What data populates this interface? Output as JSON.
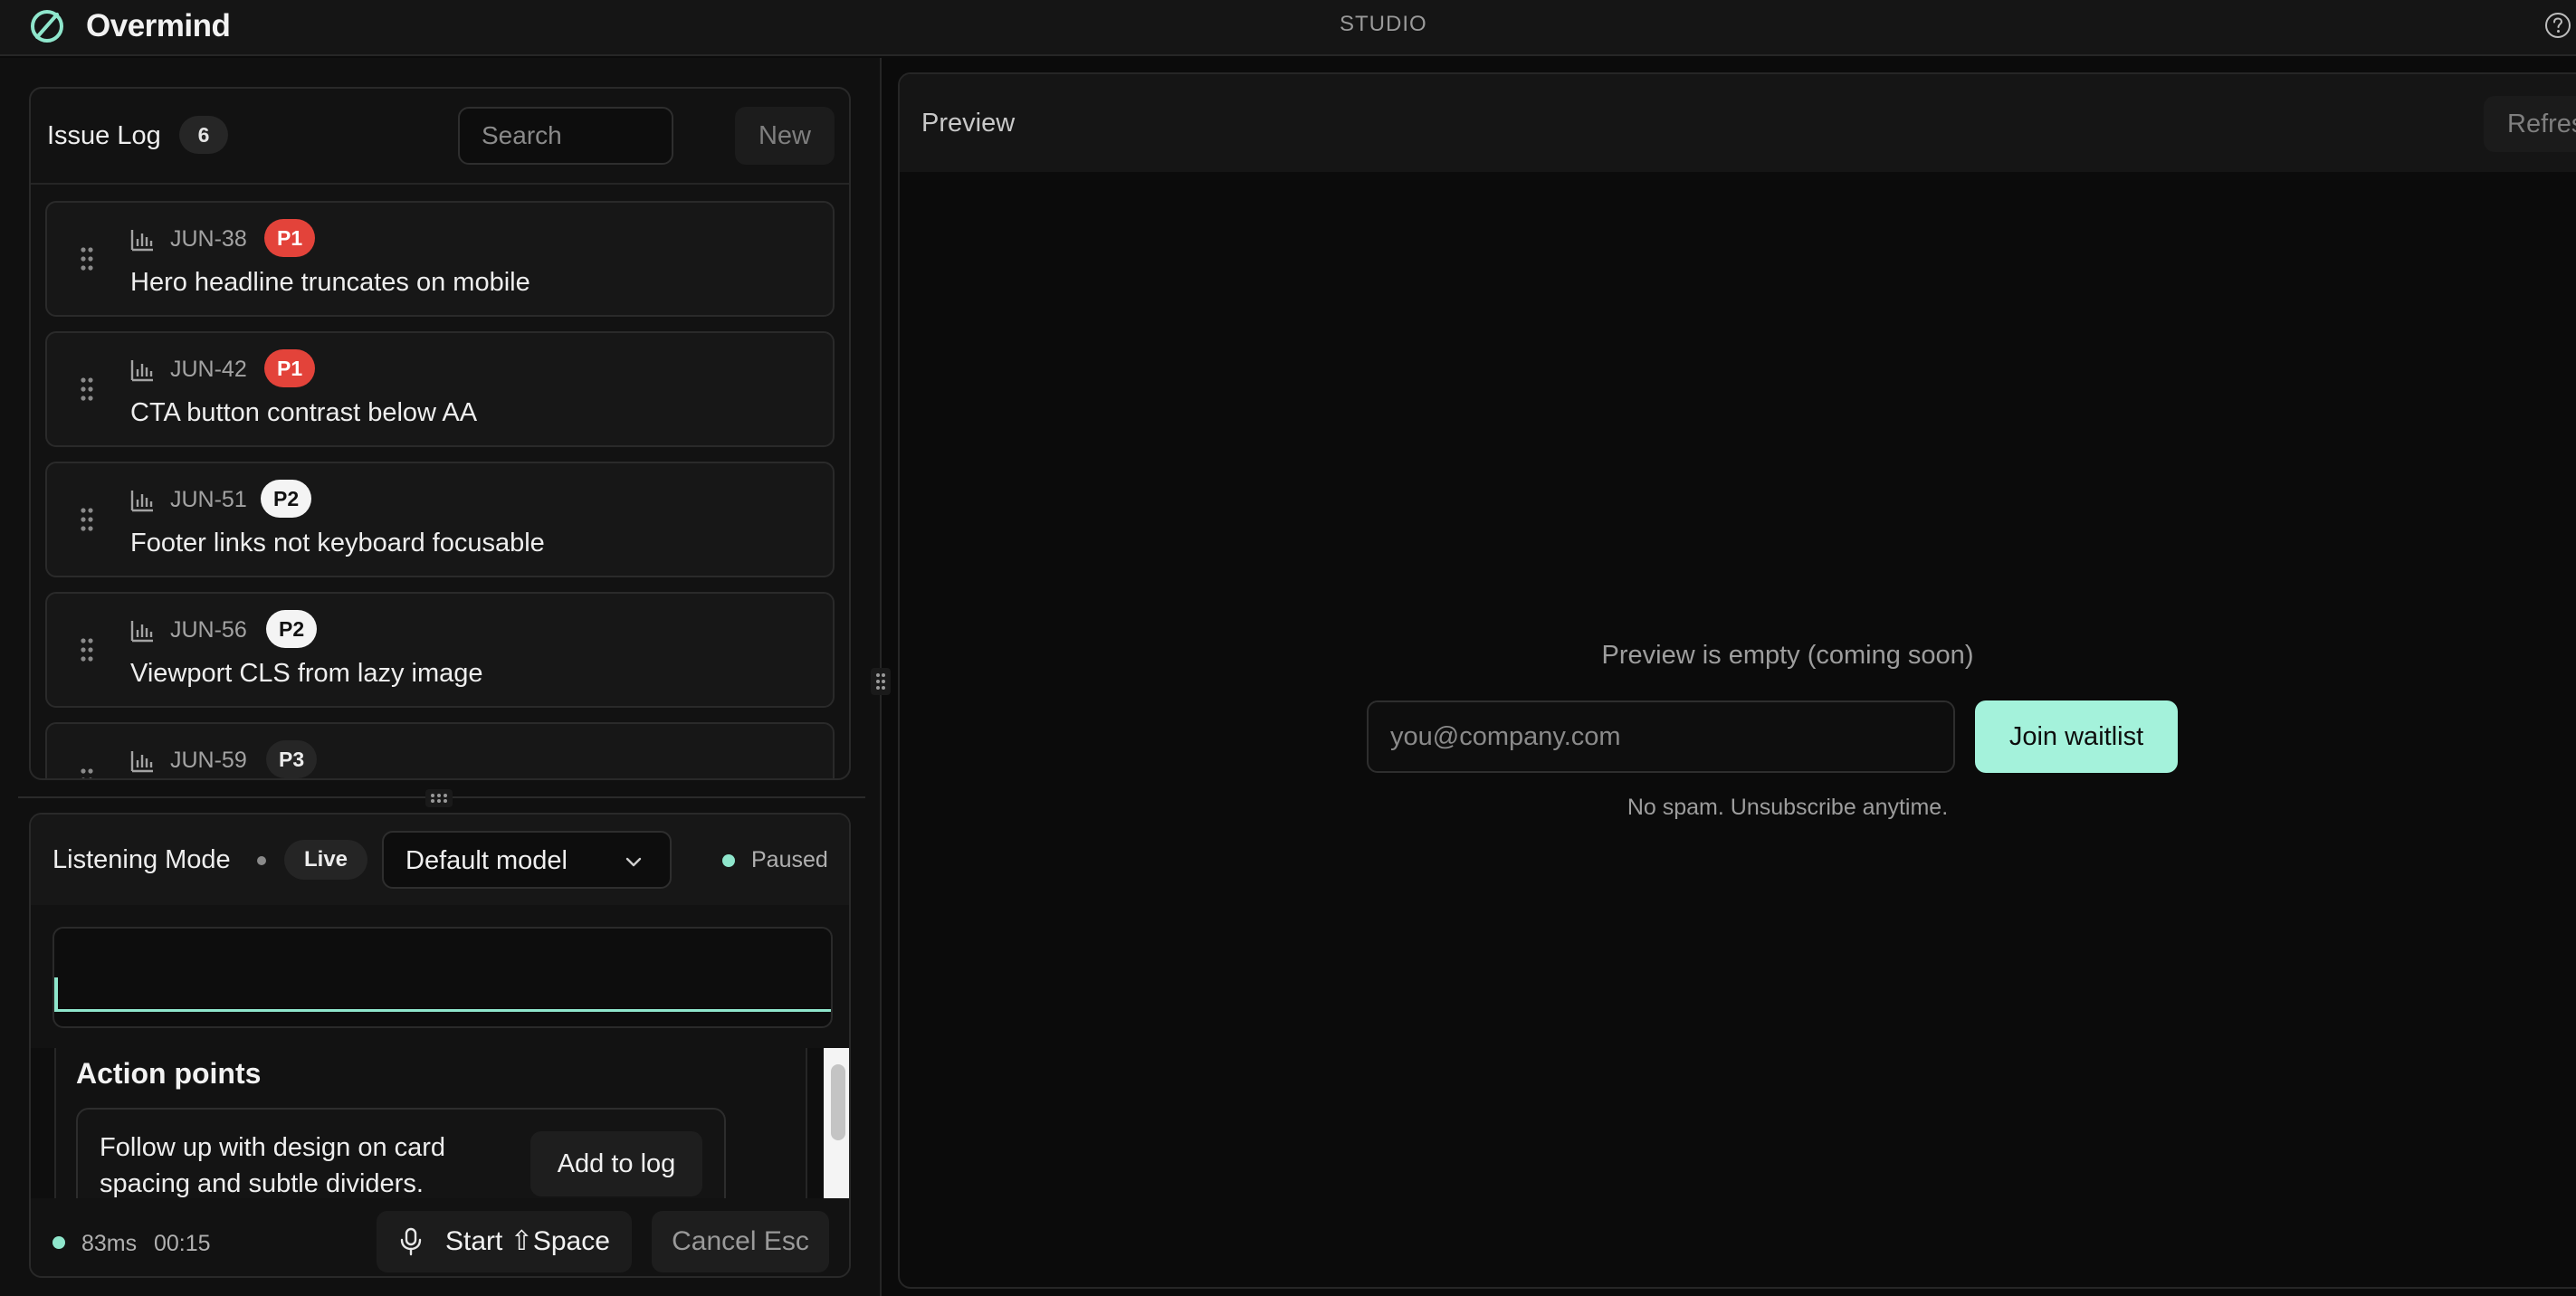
{
  "app": {
    "name": "Overmind",
    "mode_label": "STUDIO"
  },
  "issue_log": {
    "title": "Issue Log",
    "count": "6",
    "search_placeholder": "Search",
    "new_label": "New",
    "issues": [
      {
        "id": "JUN-38",
        "priority": "P1",
        "title": "Hero headline truncates on mobile"
      },
      {
        "id": "JUN-42",
        "priority": "P1",
        "title": "CTA button contrast below AA"
      },
      {
        "id": "JUN-51",
        "priority": "P2",
        "title": "Footer links not keyboard focusable"
      },
      {
        "id": "JUN-56",
        "priority": "P2",
        "title": "Viewport CLS from lazy image"
      },
      {
        "id": "JUN-59",
        "priority": "P3",
        "title": ""
      }
    ]
  },
  "listening": {
    "title": "Listening Mode",
    "live_label": "Live",
    "model_selected": "Default model",
    "status": "Paused",
    "action_points": {
      "title": "Action points",
      "items": [
        {
          "text": "Follow up with design on card spacing and subtle dividers.",
          "button": "Add to log"
        }
      ]
    },
    "latency": "83ms",
    "elapsed": "00:15",
    "start_label": "Start ⇧Space",
    "cancel_label": "Cancel Esc"
  },
  "preview": {
    "title": "Preview",
    "refresh_label": "Refresh",
    "empty_text": "Preview is empty (coming soon)",
    "email_placeholder": "you@company.com",
    "join_label": "Join waitlist",
    "fine_print": "No spam. Unsubscribe anytime."
  },
  "colors": {
    "accent": "#a4f2db",
    "p1": "#e3433a",
    "p2": "#f4f4f4",
    "p3": "#262626",
    "background": "#0b0b0b"
  },
  "icons": [
    "logo-icon",
    "help-icon",
    "drag-handle-icon",
    "bar-chart-icon",
    "chevron-down-icon",
    "mic-icon",
    "resize-handle-icon"
  ]
}
